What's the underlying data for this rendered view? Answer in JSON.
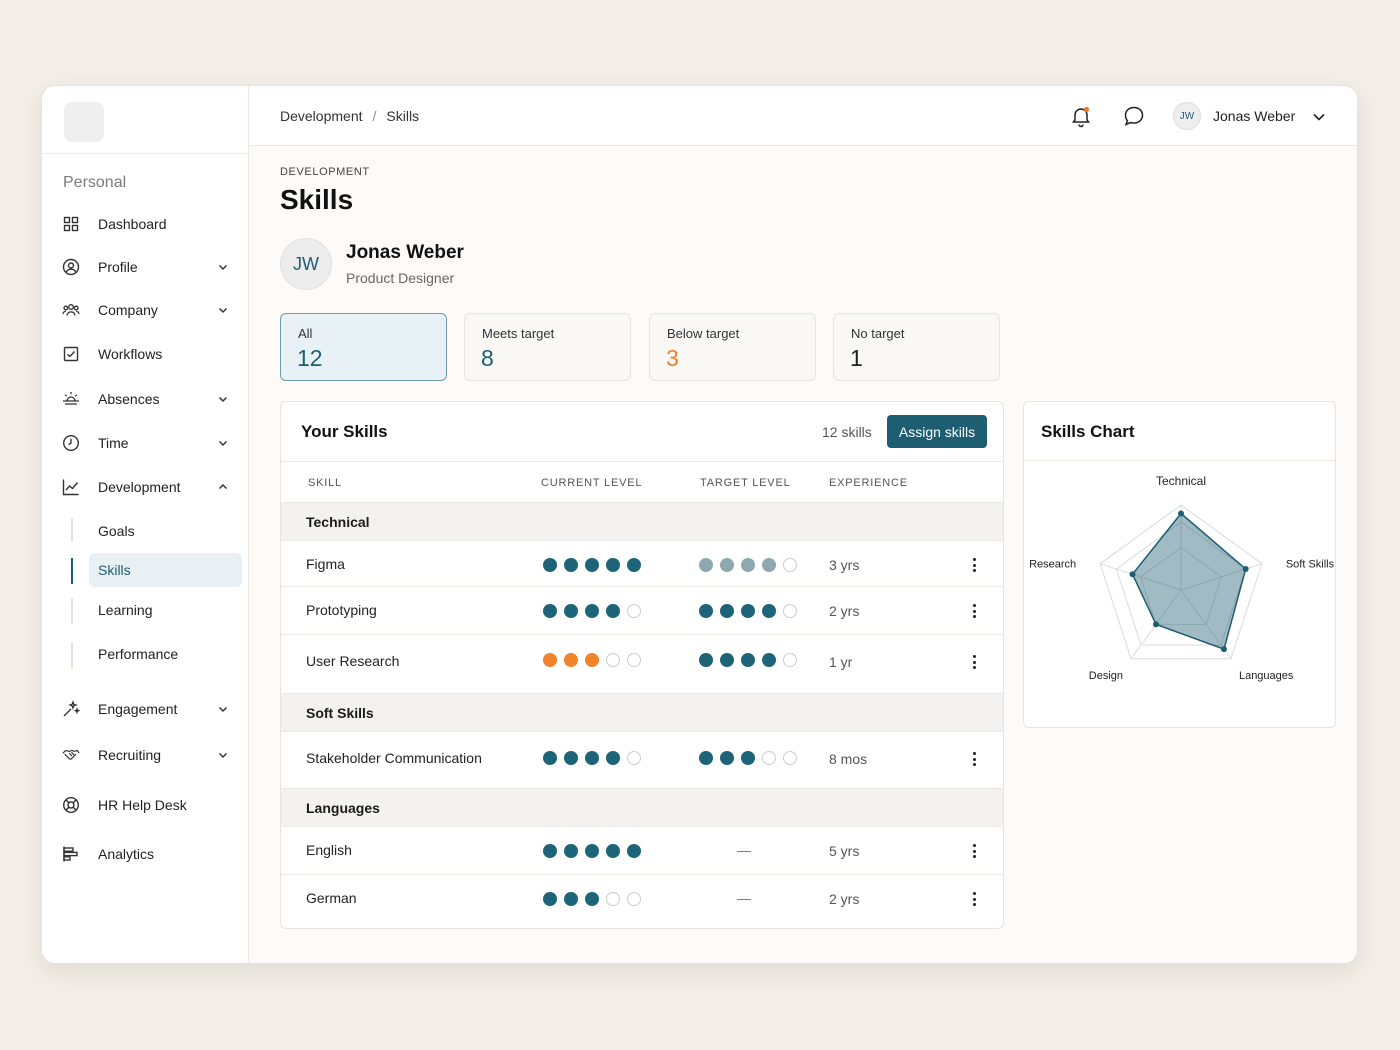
{
  "sidebar": {
    "section_label": "Personal",
    "items": [
      {
        "label": "Dashboard",
        "icon": "grid-icon"
      },
      {
        "label": "Profile",
        "icon": "user-circle-icon"
      },
      {
        "label": "Company",
        "icon": "people-icon"
      },
      {
        "label": "Workflows",
        "icon": "checkbox-icon"
      },
      {
        "label": "Absences",
        "icon": "sun-icon"
      },
      {
        "label": "Time",
        "icon": "clock-icon"
      },
      {
        "label": "Development",
        "icon": "chart-line-icon"
      },
      {
        "label": "Engagement",
        "icon": "sparkle-icon"
      },
      {
        "label": "Recruiting",
        "icon": "handshake-icon"
      },
      {
        "label": "HR Help Desk",
        "icon": "lifebuoy-icon"
      },
      {
        "label": "Analytics",
        "icon": "bar-chart-icon"
      }
    ],
    "development_sub": [
      "Goals",
      "Skills",
      "Learning",
      "Performance"
    ]
  },
  "topbar": {
    "breadcrumb": [
      "Development",
      "Skills"
    ],
    "breadcrumb_sep": "/",
    "user_initials": "JW",
    "user_name": "Jonas Weber"
  },
  "page": {
    "eyebrow": "DEVELOPMENT",
    "title": "Skills"
  },
  "person": {
    "initials": "JW",
    "name": "Jonas Weber",
    "role": "Product Designer"
  },
  "stats": [
    {
      "label": "All",
      "value": "12"
    },
    {
      "label": "Meets target",
      "value": "8"
    },
    {
      "label": "Below target",
      "value": "3"
    },
    {
      "label": "No target",
      "value": "1"
    }
  ],
  "skills_card": {
    "title": "Your Skills",
    "count": "12 skills",
    "assign_label": "Assign skills",
    "columns": [
      "SKILL",
      "CURRENT LEVEL",
      "TARGET LEVEL",
      "EXPERIENCE"
    ],
    "groups": [
      {
        "name": "Technical",
        "rows": [
          {
            "skill": "Figma",
            "current": 5,
            "target": 4,
            "experience": "3 yrs"
          },
          {
            "skill": "Prototyping",
            "current": 4,
            "target": 4,
            "experience": "2 yrs"
          },
          {
            "skill": "User Research",
            "current": 3,
            "target": 4,
            "experience": "1 yr"
          }
        ]
      },
      {
        "name": "Soft Skills",
        "rows": [
          {
            "skill": "Stakeholder Communication",
            "current": 4,
            "target": 3,
            "experience": "8 mos"
          }
        ]
      },
      {
        "name": "Languages",
        "rows": [
          {
            "skill": "English",
            "current": 5,
            "target": "—",
            "experience": "5 yrs"
          },
          {
            "skill": "German",
            "current": 3,
            "target": "—",
            "experience": "2 yrs"
          }
        ]
      }
    ]
  },
  "chart_card": {
    "title": "Skills Chart"
  },
  "colors": {
    "accent": "#1d5e73",
    "warning": "#ef842c"
  },
  "chart_data": {
    "type": "radar",
    "categories": [
      "Technical",
      "Soft Skills",
      "Languages",
      "Design",
      "Research"
    ],
    "values": [
      4.5,
      4,
      4.3,
      2.5,
      3
    ],
    "rmax": 5
  }
}
